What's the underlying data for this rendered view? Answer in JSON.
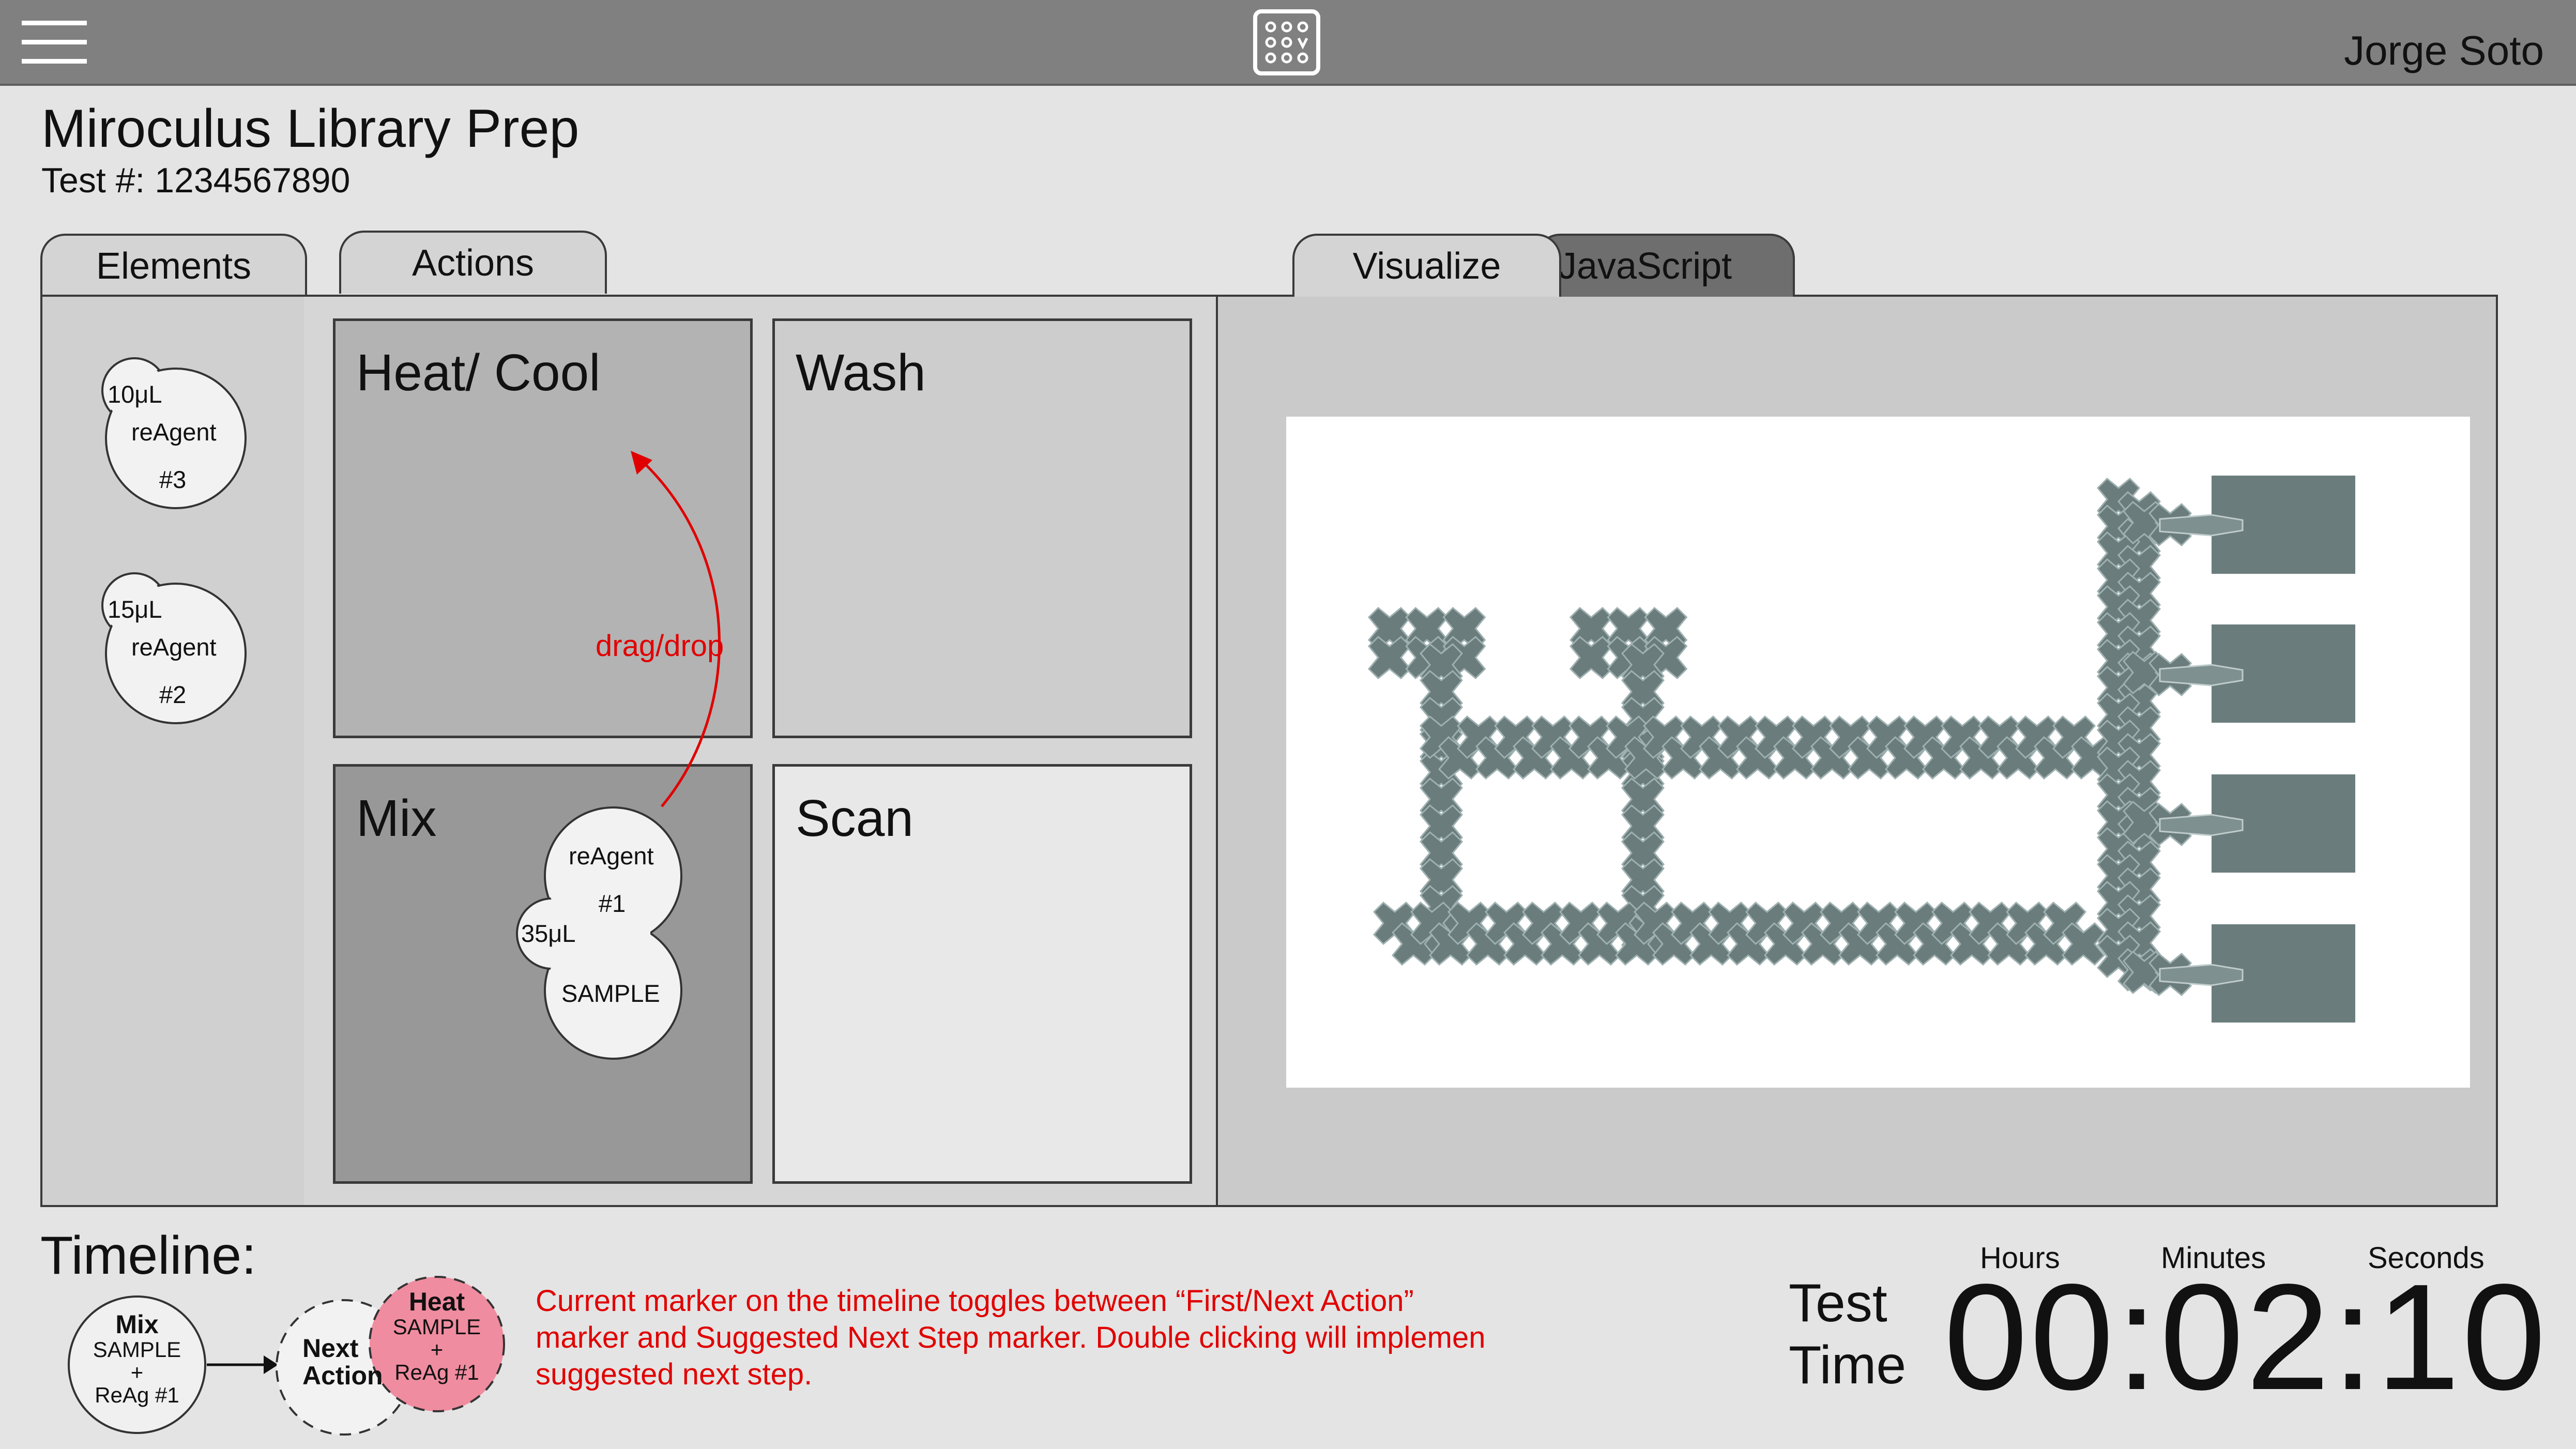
{
  "header": {
    "user_name": "Jorge Soto",
    "menu_icon": "hamburger-menu-icon",
    "logo_icon": "chip-grid-icon"
  },
  "page": {
    "title": "Miroculus Library Prep",
    "test_number": "Test #: 1234567890"
  },
  "tabs": {
    "elements": "Elements",
    "actions": "Actions",
    "visualize": "Visualize",
    "javascript": "JavaScript"
  },
  "elements": [
    {
      "volume": "10μL",
      "name": "reAgent",
      "number": "#3"
    },
    {
      "volume": "15μL",
      "name": "reAgent",
      "number": "#2"
    }
  ],
  "actions": {
    "heat_cool": "Heat/ Cool",
    "wash": "Wash",
    "mix": "Mix",
    "scan": "Scan",
    "drag_hint": "drag/drop"
  },
  "mixed_droplet": {
    "reagent": "reAgent",
    "number": "#1",
    "volume": "35μL",
    "sample": "SAMPLE"
  },
  "timeline": {
    "label": "Timeline:",
    "step1": {
      "title": "Mix",
      "line1": "SAMPLE",
      "line2": "+",
      "line3": "ReAg #1"
    },
    "next": {
      "line1": "Next",
      "line2": "Action"
    },
    "suggested": {
      "title": "Heat",
      "line1": "SAMPLE",
      "line2": "+",
      "line3": "ReAg #1"
    },
    "note": "Current marker on the timeline toggles between “First/Next Action” marker and Suggested Next Step marker. Double clicking will implemen suggested next step."
  },
  "test_time": {
    "label_line1": "Test",
    "label_line2": "Time",
    "hours_label": "Hours",
    "minutes_label": "Minutes",
    "seconds_label": "Seconds",
    "display": "00:02:10"
  },
  "colors": {
    "topbar": "#808080",
    "electrode": "#6b7c7c",
    "accent_red": "#e00000",
    "suggested_marker": "#f08ca0"
  }
}
